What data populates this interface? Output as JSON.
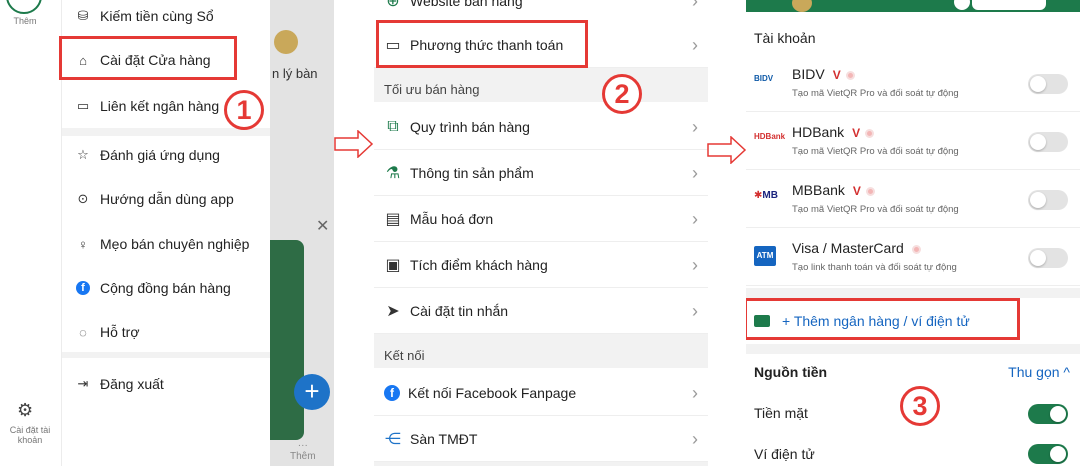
{
  "panel1": {
    "rail": {
      "top_label": "Thêm",
      "bottom_label": "Cài đặt tài khoản"
    },
    "background": {
      "partial_text": "n lý bàn",
      "more_label": "Thêm"
    },
    "menu_top": [
      {
        "icon": "coins-icon",
        "glyph": "⛁",
        "label": "Kiếm tiền cùng Sổ"
      },
      {
        "icon": "store-icon",
        "glyph": "⌂",
        "label": "Cài đặt Cửa hàng"
      },
      {
        "icon": "card-icon",
        "glyph": "▭",
        "label": "Liên kết ngân hàng"
      }
    ],
    "menu_mid": [
      {
        "icon": "star-icon",
        "glyph": "☆",
        "label": "Đánh giá ứng dụng"
      },
      {
        "icon": "play-icon",
        "glyph": "⊙",
        "label": "Hướng dẫn dùng app"
      },
      {
        "icon": "bulb-icon",
        "glyph": "♀",
        "label": "Mẹo bán chuyên nghiệp"
      },
      {
        "icon": "facebook-icon",
        "glyph": "f",
        "label": "Cộng đồng bán hàng"
      },
      {
        "icon": "chat-icon",
        "glyph": "◌",
        "label": "Hỗ trợ"
      }
    ],
    "logout": {
      "icon": "logout-icon",
      "glyph": "⇥",
      "label": "Đăng xuất"
    },
    "step": "1"
  },
  "panel2": {
    "top_rows": [
      {
        "icon": "globe-icon",
        "glyph": "⊕",
        "label": "Website bán hàng"
      },
      {
        "icon": "wallet-icon",
        "glyph": "▭",
        "label": "Phương thức thanh toán"
      }
    ],
    "section_optimize": "Tối ưu bán hàng",
    "optimize_rows": [
      {
        "icon": "workflow-icon",
        "glyph": "⧉",
        "label": "Quy trình bán hàng"
      },
      {
        "icon": "product-icon",
        "glyph": "⚗",
        "label": "Thông tin sản phẩm"
      },
      {
        "icon": "invoice-icon",
        "glyph": "▤",
        "label": "Mẫu hoá đơn"
      },
      {
        "icon": "points-icon",
        "glyph": "▣",
        "label": "Tích điểm khách hàng"
      },
      {
        "icon": "send-icon",
        "glyph": "➤",
        "label": "Cài đặt tin nhắn"
      }
    ],
    "section_connect": "Kết nối",
    "connect_rows": [
      {
        "icon": "facebook-icon",
        "glyph": "f",
        "label": "Kết nối Facebook Fanpage"
      },
      {
        "icon": "share-icon",
        "glyph": "⋲",
        "label": "Sàn TMĐT"
      }
    ],
    "step": "2"
  },
  "panel3": {
    "accounts_title": "Tài khoản",
    "banks": [
      {
        "logo": "BIDV",
        "logo_color": "#0f5aa8",
        "name": "BIDV",
        "verified": true,
        "sub": "Tạo mã VietQR Pro và đối soát tự động"
      },
      {
        "logo": "HDBank",
        "logo_color": "#d32f2f",
        "name": "HDBank",
        "verified": true,
        "sub": "Tạo mã VietQR Pro và đối soát tự động"
      },
      {
        "logo": "MB",
        "logo_color": "#1a237e",
        "name": "MBBank",
        "verified": true,
        "sub": "Tạo mã VietQR Pro và đối soát tự động"
      },
      {
        "logo": "ATM",
        "logo_color": "#1565c0",
        "name": "Visa / MasterCard",
        "verified": false,
        "sub": "Tạo link thanh toán và đối soát tự động"
      }
    ],
    "add_bank": "+ Thêm ngân hàng / ví điện tử",
    "sources_title": "Nguồn tiền",
    "collapse": "Thu gọn ^",
    "sources": [
      {
        "label": "Tiền mặt",
        "on": true
      },
      {
        "label": "Ví điện tử",
        "on": true
      }
    ],
    "step": "3"
  },
  "colors": {
    "brand_green": "#1d7a4b",
    "highlight_red": "#e53935",
    "link_blue": "#1565c0"
  }
}
